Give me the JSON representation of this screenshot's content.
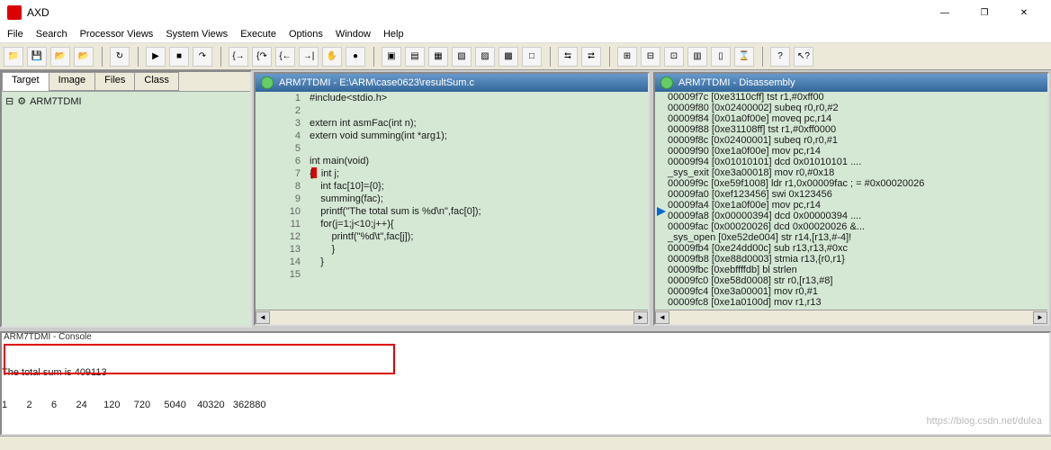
{
  "window": {
    "title": "AXD"
  },
  "menu": [
    "File",
    "Search",
    "Processor Views",
    "System Views",
    "Execute",
    "Options",
    "Window",
    "Help"
  ],
  "tabs": [
    "Target",
    "Image",
    "Files",
    "Class"
  ],
  "tree": {
    "root_label": "ARM7TDMI"
  },
  "source_window": {
    "title": "ARM7TDMI - E:\\ARM\\case0623\\resultSum.c",
    "lines": [
      "#include<stdio.h>",
      "",
      "extern int asmFac(int n);",
      "extern void summing(int *arg1);",
      "",
      "int main(void)",
      "{   int j;",
      "    int fac[10]={0};",
      "    summing(fac);",
      "    printf(\"The total sum is %d\\n\",fac[0]);",
      "    for(j=1;j<10;j++){",
      "        printf(\"%d\\t\",fac[j]);",
      "        }",
      "    }",
      ""
    ],
    "breakpoint_line": 7
  },
  "disasm_window": {
    "title": "ARM7TDMI - Disassembly",
    "rows": [
      {
        "addr": "00009f7c",
        "raw": "[0xe3110cff]",
        "mnem": "tst",
        "ops": "r1,#0xff00"
      },
      {
        "addr": "00009f80",
        "raw": "[0x02400002]",
        "mnem": "subeq",
        "ops": "r0,r0,#2"
      },
      {
        "addr": "00009f84",
        "raw": "[0x01a0f00e]",
        "mnem": "moveq",
        "ops": "pc,r14"
      },
      {
        "addr": "00009f88",
        "raw": "[0xe31108ff]",
        "mnem": "tst",
        "ops": "r1,#0xff0000"
      },
      {
        "addr": "00009f8c",
        "raw": "[0x02400001]",
        "mnem": "subeq",
        "ops": "r0,r0,#1"
      },
      {
        "addr": "00009f90",
        "raw": "[0xe1a0f00e]",
        "mnem": "mov",
        "ops": "pc,r14"
      },
      {
        "addr": "00009f94",
        "raw": "[0x01010101]",
        "mnem": "dcd",
        "ops": "0x01010101  ...."
      },
      {
        "addr": "_sys_exit",
        "raw": "[0xe3a00018]",
        "mnem": "mov",
        "ops": "r0,#0x18"
      },
      {
        "addr": "00009f9c",
        "raw": "[0xe59f1008]",
        "mnem": "ldr",
        "ops": "r1,0x00009fac ; = #0x00020026"
      },
      {
        "addr": "00009fa0",
        "raw": "[0xef123456]",
        "mnem": "swi",
        "ops": "0x123456",
        "current": true
      },
      {
        "addr": "00009fa4",
        "raw": "[0xe1a0f00e]",
        "mnem": "mov",
        "ops": "pc,r14"
      },
      {
        "addr": "00009fa8",
        "raw": "[0x00000394]",
        "mnem": "dcd",
        "ops": "0x00000394  ...."
      },
      {
        "addr": "00009fac",
        "raw": "[0x00020026]",
        "mnem": "dcd",
        "ops": "0x00020026  &..."
      },
      {
        "addr": "_sys_open",
        "raw": "[0xe52de004]",
        "mnem": "str",
        "ops": "r14,[r13,#-4]!"
      },
      {
        "addr": "00009fb4",
        "raw": "[0xe24dd00c]",
        "mnem": "sub",
        "ops": "r13,r13,#0xc"
      },
      {
        "addr": "00009fb8",
        "raw": "[0xe88d0003]",
        "mnem": "stmia",
        "ops": "r13,{r0,r1}"
      },
      {
        "addr": "00009fbc",
        "raw": "[0xebffffdb]",
        "mnem": "bl",
        "ops": "strlen"
      },
      {
        "addr": "00009fc0",
        "raw": "[0xe58d0008]",
        "mnem": "str",
        "ops": "r0,[r13,#8]"
      },
      {
        "addr": "00009fc4",
        "raw": "[0xe3a00001]",
        "mnem": "mov",
        "ops": "r0,#1"
      },
      {
        "addr": "00009fc8",
        "raw": "[0xe1a0100d]",
        "mnem": "mov",
        "ops": "r1,r13"
      }
    ]
  },
  "console": {
    "title": "ARM7TDMI - Console",
    "lines": [
      "The total sum is 409113",
      "1       2       6       24      120     720     5040    40320   362880"
    ]
  },
  "watermark": "https://blog.csdn.net/dulea"
}
